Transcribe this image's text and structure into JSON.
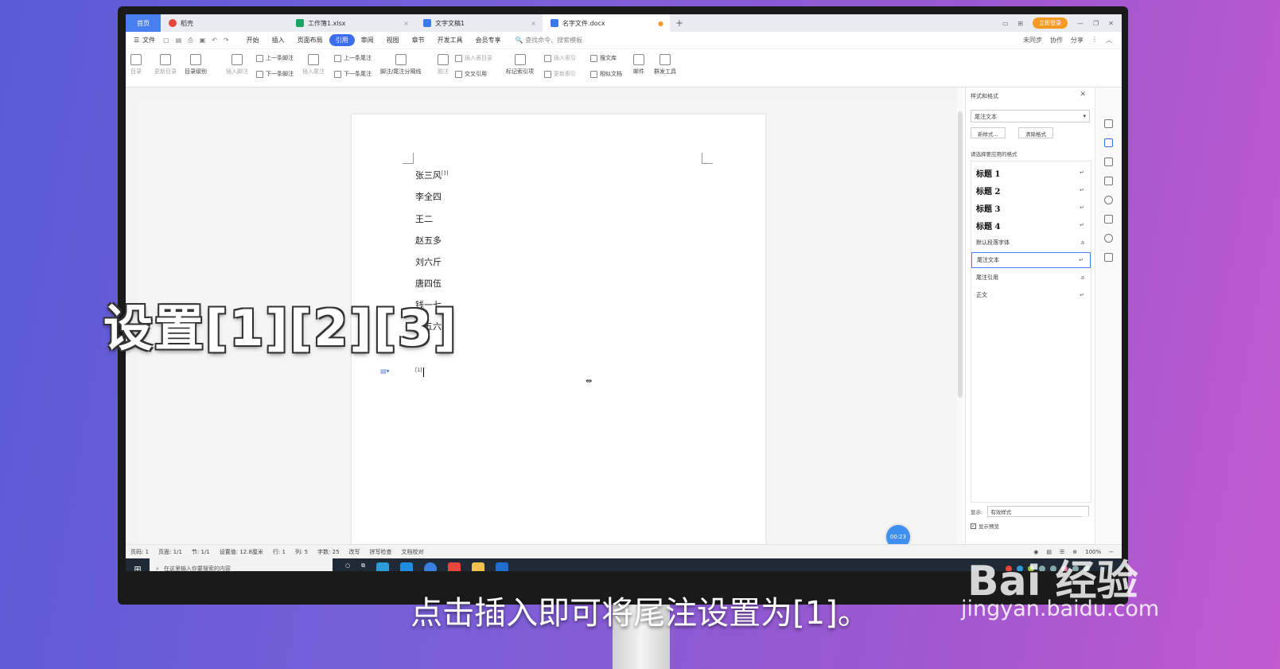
{
  "tabs": [
    {
      "label": "首页",
      "color": "#4a7ff2"
    },
    {
      "label": "稻壳",
      "color": "#e8453c"
    },
    {
      "label": "工作簿1.xlsx",
      "color": "#21a366"
    },
    {
      "label": "文字文稿1",
      "color": "#3b7ae8"
    },
    {
      "label": "名字文件.docx",
      "color": "#3b7ae8"
    }
  ],
  "tab_add": "+",
  "login": "立即登录",
  "menu": {
    "file": "文件",
    "items": [
      "开始",
      "插入",
      "页面布局",
      "引用",
      "审阅",
      "视图",
      "章节",
      "开发工具",
      "会员专享"
    ],
    "active": "引用",
    "search": "查找命令、搜索模板",
    "right": [
      "未同步",
      "协作",
      "分享"
    ]
  },
  "ribbon": {
    "toc": "目录",
    "update_toc": "更新目录",
    "toc_level": "目录级别",
    "insert_footnote": "插入脚注",
    "prev_footnote": "上一条脚注",
    "next_footnote": "下一条脚注",
    "insert_endnote": "插入尾注",
    "prev_endnote": "上一条尾注",
    "next_endnote": "下一条尾注",
    "separator": "脚注/尾注分隔线",
    "caption": "题注",
    "insert_table_of_figures": "插入表目录",
    "cross_ref": "交叉引用",
    "mark_index": "标记索引项",
    "insert_index": "插入索引",
    "update_index": "更新索引",
    "search_lib": "搜文库",
    "similar_doc": "相似文档",
    "mail": "邮件",
    "mass_tools": "群发工具"
  },
  "document": {
    "lines": [
      "张三风",
      "李全四",
      "王二",
      "赵五多",
      "刘六斤",
      "唐四伍",
      "钱一七",
      "孙五六"
    ],
    "first_line_mark": "[1]",
    "endnote_mark": "[1]"
  },
  "timer": "00:23",
  "styles_panel": {
    "title": "样式和格式",
    "current": "尾注文本",
    "new_style": "新样式...",
    "clear_format": "清除格式",
    "hint": "请选择要应用的格式",
    "items": [
      "标题 1",
      "标题 2",
      "标题 3",
      "标题 4",
      "默认段落字体",
      "尾注文本",
      "尾注引用",
      "正文"
    ],
    "show_label": "显示:",
    "show_value": "有效样式",
    "preview": "显示预览"
  },
  "status": {
    "page_no": "页码: 1",
    "pages": "页面: 1/1",
    "section": "节: 1/1",
    "position": "设置值: 12.8厘米",
    "row": "行: 1",
    "col": "列: 5",
    "words": "字数: 25",
    "rewrite": "改写",
    "spell": "拼写检查",
    "proof": "文档校对",
    "zoom": "100%"
  },
  "taskbar": {
    "search_placeholder": "在这里输入你要搜索的内容"
  },
  "overlay_title": "设置[1][2][3]",
  "subtitle": "点击插入即可将尾注设置为[1]。",
  "watermark": {
    "logo": "Bai 经验",
    "url": "jingyan.baidu.com"
  }
}
